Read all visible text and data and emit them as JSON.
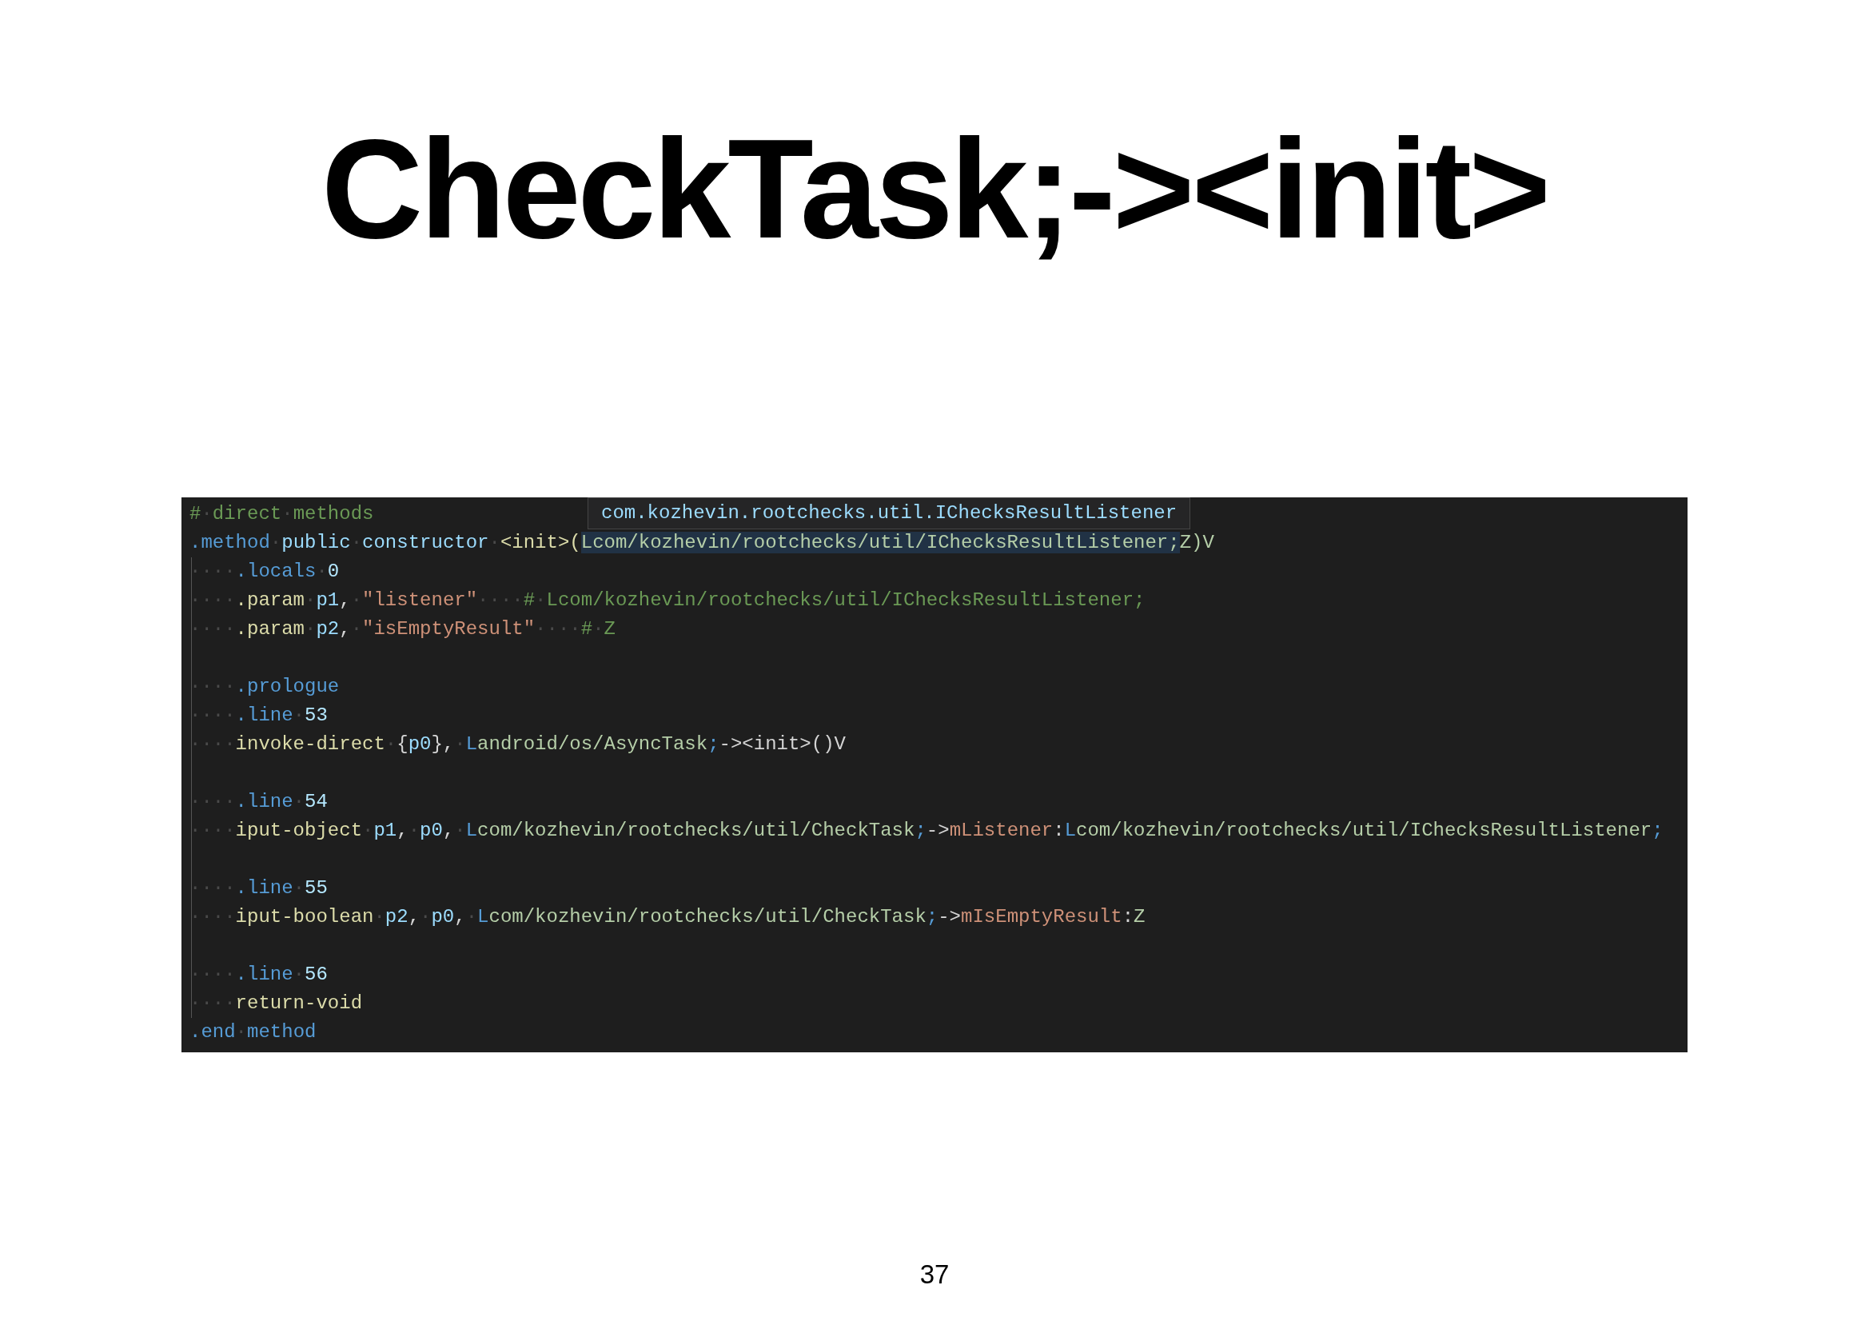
{
  "slide": {
    "title": "CheckTask;-><init>",
    "page_number": "37"
  },
  "code_editor": {
    "hover_tooltip": {
      "text": "com.kozhevin.rootchecks.util.IChecksResultListener"
    },
    "lines": [
      {
        "kind": "code",
        "tokens": [
          {
            "kind": "comment",
            "text": "#"
          },
          {
            "kind": "ws",
            "text": "·"
          },
          {
            "kind": "comment",
            "text": "direct"
          },
          {
            "kind": "ws",
            "text": "·"
          },
          {
            "kind": "comment",
            "text": "methods"
          }
        ]
      },
      {
        "kind": "code",
        "tokens": [
          {
            "kind": "directive",
            "text": ".method"
          },
          {
            "kind": "ws",
            "text": "·"
          },
          {
            "kind": "keyword",
            "text": "public"
          },
          {
            "kind": "ws",
            "text": "·"
          },
          {
            "kind": "keyword",
            "text": "constructor"
          },
          {
            "kind": "ws",
            "text": "·"
          },
          {
            "kind": "instr",
            "text": "<init>("
          },
          {
            "kind": "selected_type",
            "text": "Lcom/kozhevin/rootchecks/util/IChecksResultListener;"
          },
          {
            "kind": "type",
            "text": "Z)V"
          }
        ]
      },
      {
        "kind": "code",
        "tokens": [
          {
            "kind": "ws",
            "text": "····"
          },
          {
            "kind": "directive",
            "text": ".locals"
          },
          {
            "kind": "ws",
            "text": "·"
          },
          {
            "kind": "number",
            "text": "0"
          }
        ]
      },
      {
        "kind": "code",
        "tokens": [
          {
            "kind": "ws",
            "text": "····"
          },
          {
            "kind": "instr",
            "text": ".param"
          },
          {
            "kind": "ws",
            "text": "·"
          },
          {
            "kind": "keyword",
            "text": "p1"
          },
          {
            "kind": "punct",
            "text": ","
          },
          {
            "kind": "ws",
            "text": "·"
          },
          {
            "kind": "string",
            "text": "\"listener\""
          },
          {
            "kind": "ws",
            "text": "····"
          },
          {
            "kind": "comment",
            "text": "#"
          },
          {
            "kind": "ws",
            "text": "·"
          },
          {
            "kind": "comment",
            "text": "Lcom/kozhevin/rootchecks/util/IChecksResultListener;"
          }
        ]
      },
      {
        "kind": "code",
        "tokens": [
          {
            "kind": "ws",
            "text": "····"
          },
          {
            "kind": "instr",
            "text": ".param"
          },
          {
            "kind": "ws",
            "text": "·"
          },
          {
            "kind": "keyword",
            "text": "p2"
          },
          {
            "kind": "punct",
            "text": ","
          },
          {
            "kind": "ws",
            "text": "·"
          },
          {
            "kind": "string",
            "text": "\"isEmptyResult\""
          },
          {
            "kind": "ws",
            "text": "····"
          },
          {
            "kind": "comment",
            "text": "#"
          },
          {
            "kind": "ws",
            "text": "·"
          },
          {
            "kind": "comment",
            "text": "Z"
          }
        ]
      },
      {
        "kind": "blank"
      },
      {
        "kind": "code",
        "tokens": [
          {
            "kind": "ws",
            "text": "····"
          },
          {
            "kind": "directive",
            "text": ".prologue"
          }
        ]
      },
      {
        "kind": "code",
        "tokens": [
          {
            "kind": "ws",
            "text": "····"
          },
          {
            "kind": "directive",
            "text": ".line"
          },
          {
            "kind": "ws",
            "text": "·"
          },
          {
            "kind": "number",
            "text": "53"
          }
        ]
      },
      {
        "kind": "code",
        "tokens": [
          {
            "kind": "ws",
            "text": "····"
          },
          {
            "kind": "instr",
            "text": "invoke-direct"
          },
          {
            "kind": "ws",
            "text": "·"
          },
          {
            "kind": "punct",
            "text": "{"
          },
          {
            "kind": "keyword",
            "text": "p0"
          },
          {
            "kind": "punct",
            "text": "},"
          },
          {
            "kind": "ws",
            "text": "·"
          },
          {
            "kind": "typeprefix",
            "text": "L"
          },
          {
            "kind": "type",
            "text": "android/os/AsyncTask"
          },
          {
            "kind": "typeprefix",
            "text": ";"
          },
          {
            "kind": "punct",
            "text": "-><init>()V"
          }
        ]
      },
      {
        "kind": "blank"
      },
      {
        "kind": "code",
        "tokens": [
          {
            "kind": "ws",
            "text": "····"
          },
          {
            "kind": "directive",
            "text": ".line"
          },
          {
            "kind": "ws",
            "text": "·"
          },
          {
            "kind": "number",
            "text": "54"
          }
        ]
      },
      {
        "kind": "code",
        "tokens": [
          {
            "kind": "ws",
            "text": "····"
          },
          {
            "kind": "instr",
            "text": "iput-object"
          },
          {
            "kind": "ws",
            "text": "·"
          },
          {
            "kind": "keyword",
            "text": "p1"
          },
          {
            "kind": "punct",
            "text": ","
          },
          {
            "kind": "ws",
            "text": "·"
          },
          {
            "kind": "keyword",
            "text": "p0"
          },
          {
            "kind": "punct",
            "text": ","
          },
          {
            "kind": "ws",
            "text": "·"
          },
          {
            "kind": "typeprefix",
            "text": "L"
          },
          {
            "kind": "type",
            "text": "com/kozhevin/rootchecks/util/CheckTask"
          },
          {
            "kind": "typeprefix",
            "text": ";"
          },
          {
            "kind": "punct",
            "text": "->"
          },
          {
            "kind": "field",
            "text": "mListener"
          },
          {
            "kind": "punct",
            "text": ":"
          },
          {
            "kind": "typeprefix",
            "text": "L"
          },
          {
            "kind": "type",
            "text": "com/kozhevin/rootchecks/util/IChecksResultListener"
          },
          {
            "kind": "typeprefix",
            "text": ";"
          }
        ]
      },
      {
        "kind": "blank"
      },
      {
        "kind": "code",
        "tokens": [
          {
            "kind": "ws",
            "text": "····"
          },
          {
            "kind": "directive",
            "text": ".line"
          },
          {
            "kind": "ws",
            "text": "·"
          },
          {
            "kind": "number",
            "text": "55"
          }
        ]
      },
      {
        "kind": "code",
        "tokens": [
          {
            "kind": "ws",
            "text": "····"
          },
          {
            "kind": "instr",
            "text": "iput-boolean"
          },
          {
            "kind": "ws",
            "text": "·"
          },
          {
            "kind": "keyword",
            "text": "p2"
          },
          {
            "kind": "punct",
            "text": ","
          },
          {
            "kind": "ws",
            "text": "·"
          },
          {
            "kind": "keyword",
            "text": "p0"
          },
          {
            "kind": "punct",
            "text": ","
          },
          {
            "kind": "ws",
            "text": "·"
          },
          {
            "kind": "typeprefix",
            "text": "L"
          },
          {
            "kind": "type",
            "text": "com/kozhevin/rootchecks/util/CheckTask"
          },
          {
            "kind": "typeprefix",
            "text": ";"
          },
          {
            "kind": "punct",
            "text": "->"
          },
          {
            "kind": "field",
            "text": "mIsEmptyResult"
          },
          {
            "kind": "punct",
            "text": ":"
          },
          {
            "kind": "type",
            "text": "Z"
          }
        ]
      },
      {
        "kind": "blank"
      },
      {
        "kind": "code",
        "tokens": [
          {
            "kind": "ws",
            "text": "····"
          },
          {
            "kind": "directive",
            "text": ".line"
          },
          {
            "kind": "ws",
            "text": "·"
          },
          {
            "kind": "number",
            "text": "56"
          }
        ]
      },
      {
        "kind": "code",
        "tokens": [
          {
            "kind": "ws",
            "text": "····"
          },
          {
            "kind": "instr",
            "text": "return-void"
          }
        ]
      },
      {
        "kind": "code",
        "tokens": [
          {
            "kind": "directive",
            "text": ".end"
          },
          {
            "kind": "ws",
            "text": "·"
          },
          {
            "kind": "directive",
            "text": "method"
          }
        ]
      }
    ]
  }
}
